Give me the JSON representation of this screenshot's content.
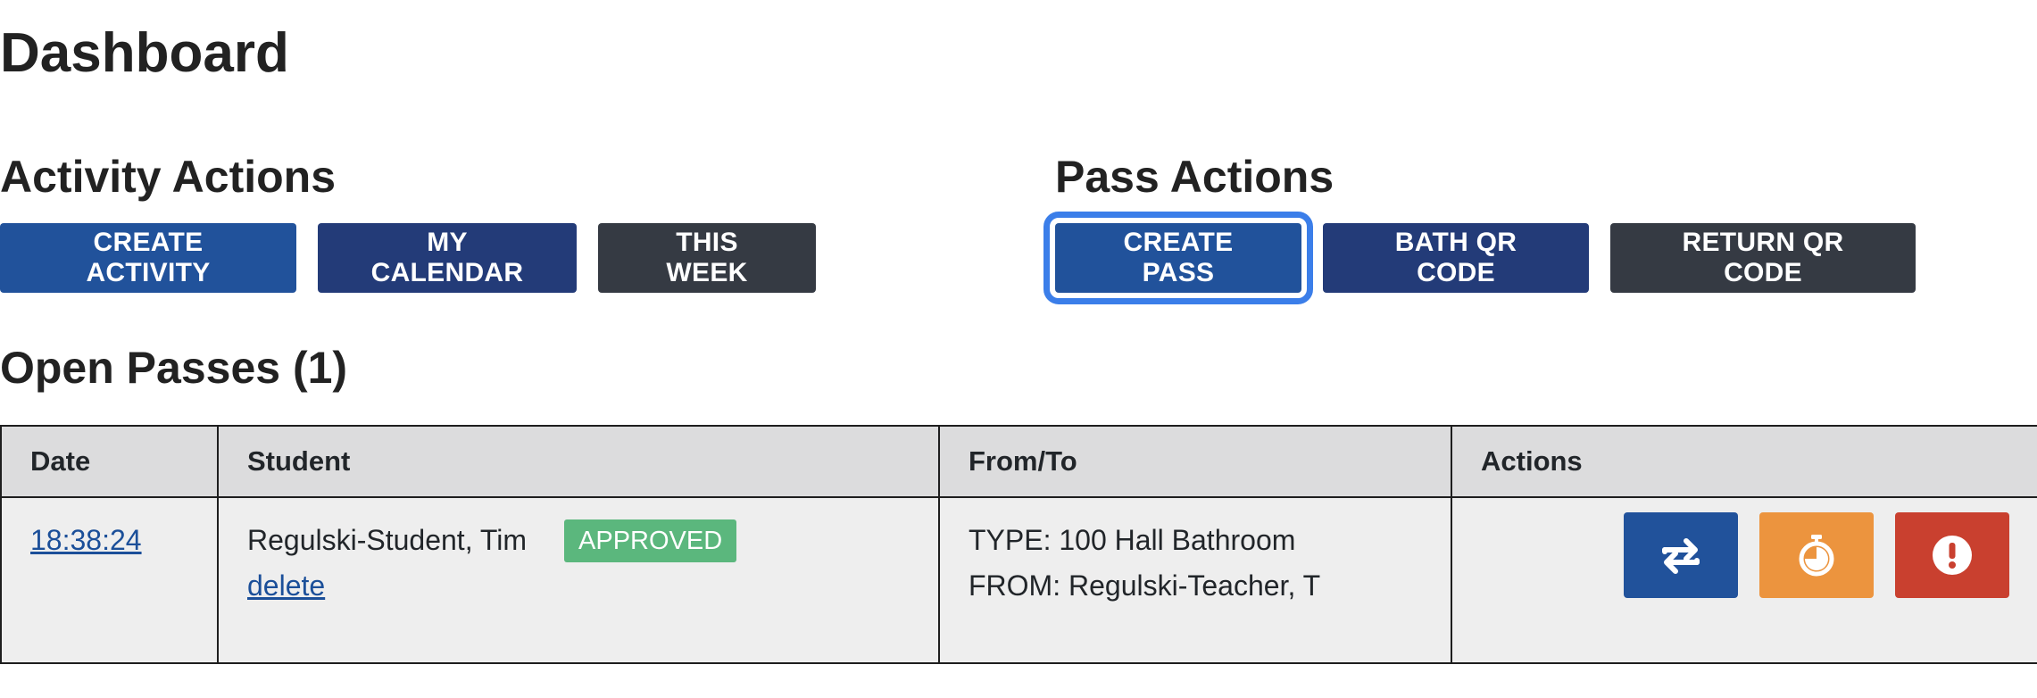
{
  "page": {
    "title": "Dashboard"
  },
  "activity_actions": {
    "title": "Activity Actions",
    "buttons": {
      "create_activity": "CREATE ACTIVITY",
      "my_calendar": "MY CALENDAR",
      "this_week": "THIS WEEK"
    }
  },
  "pass_actions": {
    "title": "Pass Actions",
    "buttons": {
      "create_pass": "CREATE PASS",
      "bath_qr_code": "BATH QR CODE",
      "return_qr_code": "RETURN QR CODE"
    }
  },
  "open_passes": {
    "title": "Open Passes (1)",
    "columns": [
      "Date",
      "Student",
      "From/To",
      "Actions"
    ],
    "rows": [
      {
        "date": "18:38:24",
        "student": "Regulski-Student, Tim",
        "status": "APPROVED",
        "delete_label": "delete",
        "type_line": "TYPE: 100 Hall Bathroom",
        "from_line": "FROM: Regulski-Teacher, T",
        "action_icons": [
          "swap-arrows-icon",
          "stopwatch-icon",
          "exclamation-circle-icon"
        ]
      }
    ]
  },
  "colors": {
    "primary": "#21529b",
    "navy": "#233b78",
    "dark": "#353a43",
    "focus_ring": "#3b7ee9",
    "approved": "#5bb77d",
    "warning": "#ec943e",
    "danger": "#c9402f"
  }
}
